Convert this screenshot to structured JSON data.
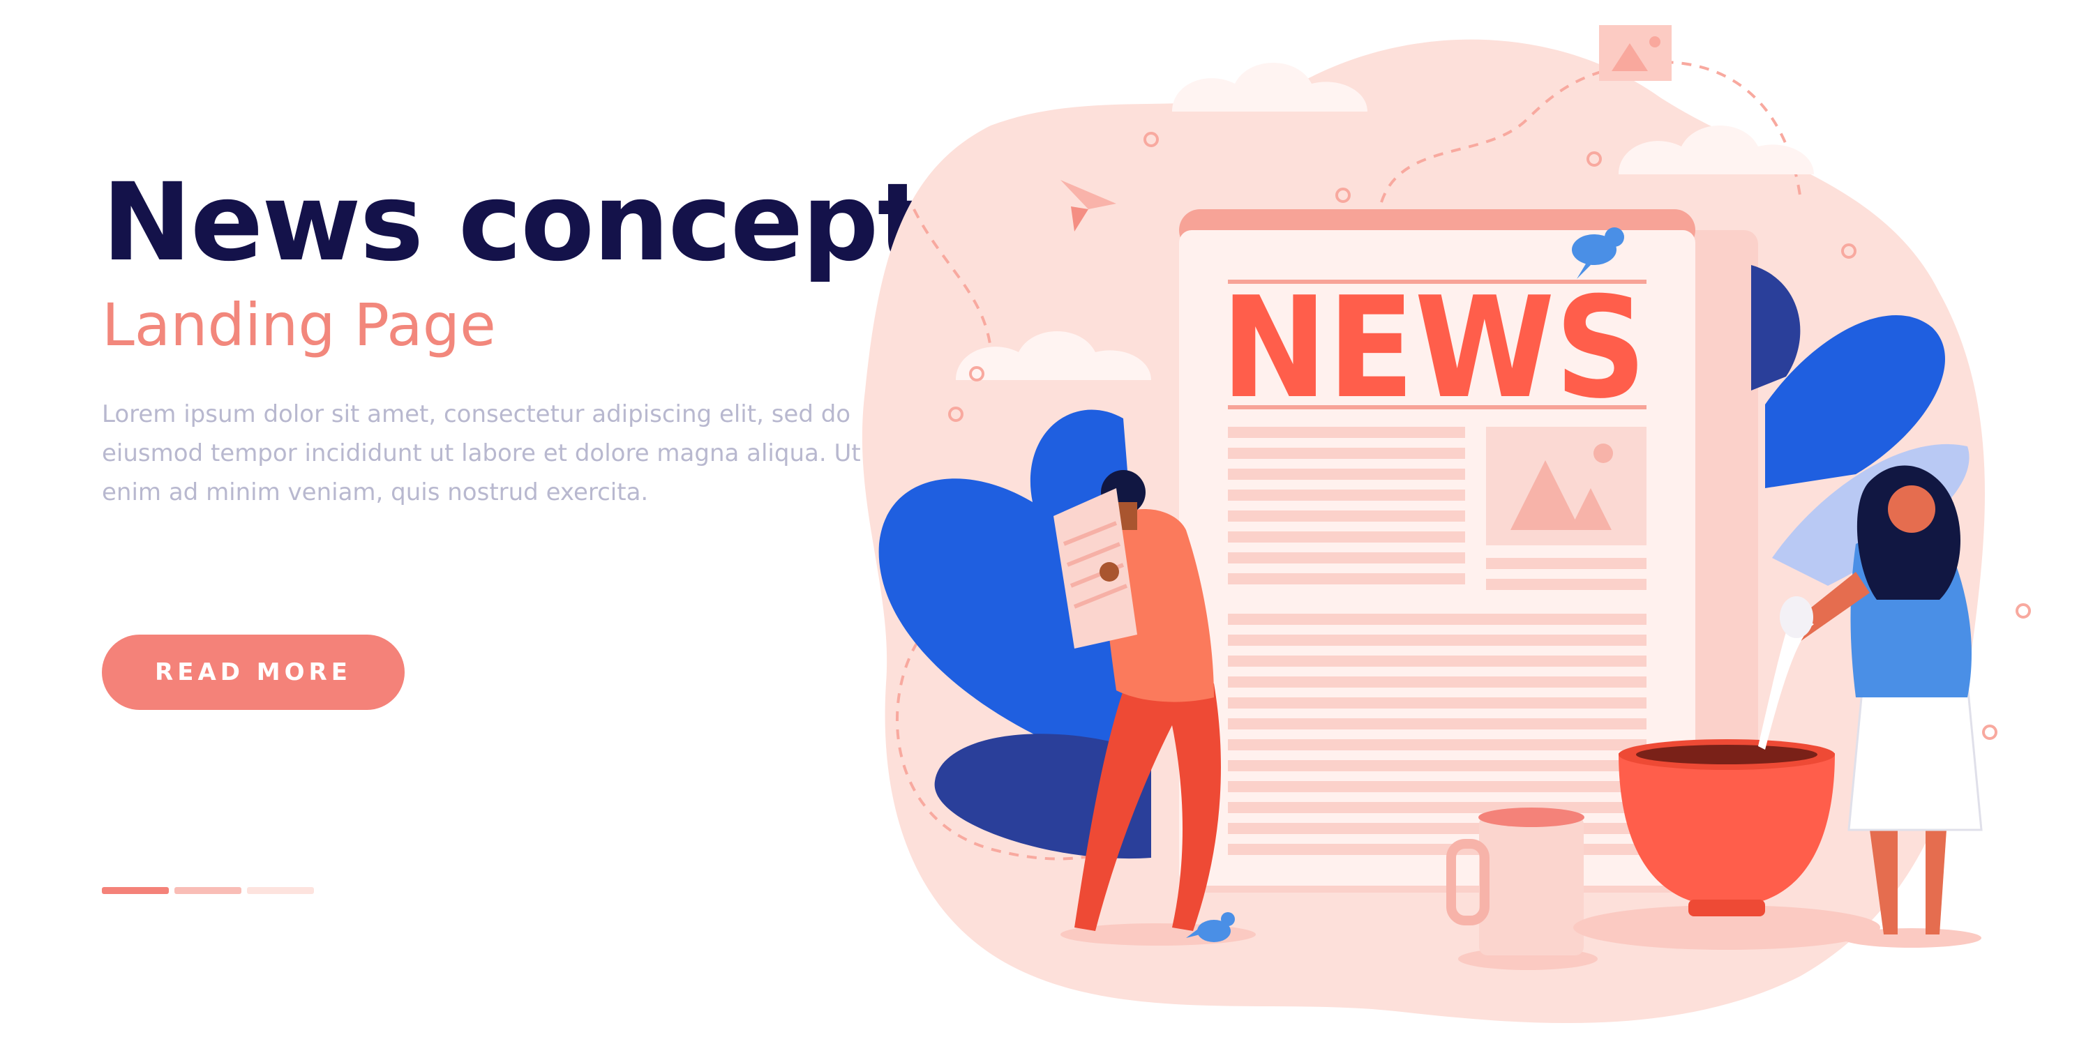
{
  "hero": {
    "title": "News concept",
    "subtitle": "Landing Page",
    "body": "Lorem ipsum dolor sit amet, consectetur adipiscing elit, sed do eiusmod tempor incididunt ut labore et dolore magna aliqua. Ut enim ad minim veniam, quis nostrud exercita.",
    "cta_label": "READ MORE"
  },
  "illustration": {
    "masthead": "NEWS"
  },
  "pager": {
    "slides": [
      "slide-1",
      "slide-2",
      "slide-3"
    ],
    "active_index": 0
  },
  "colors": {
    "navy": "#14124a",
    "coral": "#f48279",
    "news_red": "#ff5e4b",
    "blob_pink": "#fde0da",
    "leaf_blue": "#1f5fe0",
    "leaf_navy": "#2a3f9a",
    "shirt_blue": "#4a8fe6",
    "body_gray": "#b8b8cf"
  },
  "icons": [
    "paper-plane-icon",
    "image-placeholder-icon",
    "bird-icon",
    "newspaper-icon",
    "coffee-cup-icon",
    "mug-icon"
  ]
}
